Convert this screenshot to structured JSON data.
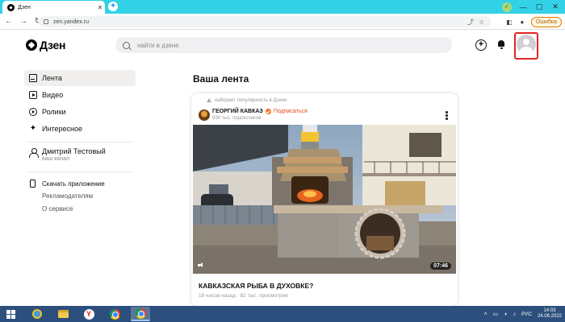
{
  "browser": {
    "tab_title": "Дзен",
    "tab_close": "✕",
    "new_tab": "+",
    "url": "zen.yandex.ru",
    "profile_letter": "✓",
    "error_label": "Ошибка",
    "window_controls": [
      "—",
      "▢",
      "✕"
    ],
    "nav": {
      "back": "←",
      "forward": "→",
      "reload": "↻"
    },
    "omni_icons": [
      "⤴",
      "☆"
    ],
    "toolbar_icons": [
      "◧",
      "●"
    ]
  },
  "header": {
    "logo_text": "Дзен",
    "search_placeholder": "найти в дзене",
    "create_label": "+"
  },
  "sidebar": {
    "items": [
      {
        "label": "Лента",
        "icon": "feed-icon",
        "active": true
      },
      {
        "label": "Видео",
        "icon": "video-icon"
      },
      {
        "label": "Ролики",
        "icon": "shorts-icon"
      },
      {
        "label": "Интересное",
        "icon": "sparkle-icon"
      }
    ],
    "sparkle_glyph": "✦",
    "channel": {
      "name": "Дмитрий Тестовый",
      "subtitle": "ваш канал"
    },
    "links": [
      "Скачать приложение",
      "Рекламодателям",
      "О сервисе"
    ]
  },
  "feed": {
    "title": "Ваша лента",
    "card": {
      "trend_note": "набирает популярность в Дзене",
      "channel_name": "ГЕОРГИЙ КАВКАЗ",
      "subscribe_label": "Подписаться",
      "subscribers": "698 тыс. подписчиков",
      "duration": "07:46",
      "title": "КАВКАЗСКАЯ РЫБА В ДУХОВКЕ?",
      "meta": "18 часов назад · 82 тыс. просмотров"
    }
  },
  "taskbar": {
    "apps": [
      "internet-explorer",
      "file-explorer",
      "yandex-browser",
      "chrome",
      "chrome"
    ],
    "yandex_letter": "Y",
    "tray_icons": [
      "˄",
      "▭",
      "◖",
      "♪"
    ],
    "language": "РУС",
    "time": "14:03",
    "date": "24.06.2022"
  },
  "colors": {
    "tabbar": "#33d1e6",
    "accent_subscribe": "#e64a19",
    "highlight": "#e02424",
    "taskbar": "#2d4f7d"
  }
}
